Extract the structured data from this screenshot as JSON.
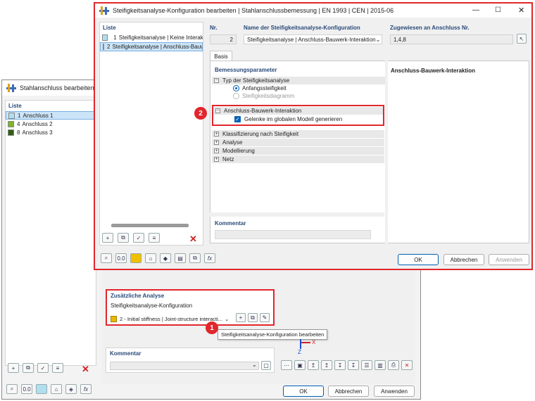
{
  "back_window": {
    "title": "Stahlanschluss bearbeiten",
    "list_title": "Liste",
    "items": [
      {
        "num": "1",
        "label": "Anschluss 1",
        "color": "#b0dff0"
      },
      {
        "num": "4",
        "label": "Anschluss 2",
        "color": "#7fb528"
      },
      {
        "num": "8",
        "label": "Anschluss 3",
        "color": "#2f5e10"
      }
    ],
    "additional_analysis": {
      "title": "Zusätzliche Analyse",
      "config_label": "Steifigkeitsanalyse-Konfiguration",
      "config_value": "2 - Initial stiffness | Joint-structure interacti...",
      "tooltip": "Steifigkeitsanalyse-Konfiguration bearbeiten"
    },
    "comment_title": "Kommentar",
    "buttons": {
      "ok": "OK",
      "cancel": "Abbrechen",
      "apply": "Anwenden"
    },
    "axis_z": "Z",
    "axis_x": "X"
  },
  "front_window": {
    "title": "Steifigkeitsanalyse-Konfiguration bearbeiten | Stahlanschlussbemessung | EN 1993 | CEN | 2015-06",
    "list_title": "Liste",
    "items": [
      {
        "num": "1",
        "label": "Steifigkeitsanalyse | Keine Interaktion",
        "color": "#b0dff0"
      },
      {
        "num": "2",
        "label": "Steifigkeitsanalyse | Anschluss-Bauwe",
        "color": "#8a8a20"
      }
    ],
    "nr_label": "Nr.",
    "nr_value": "2",
    "name_label": "Name der Steifigkeitsanalyse-Konfiguration",
    "name_value": "Steifigkeitsanalyse | Anschluss-Bauwerk-Interaktion",
    "assigned_label": "Zugewiesen an Anschluss Nr.",
    "assigned_value": "1,4,8",
    "tab": "Basis",
    "params_title": "Bemessungsparameter",
    "tree": {
      "type_group": "Typ der Steifigkeitsanalyse",
      "radio1": "Anfangssteifigkeit",
      "radio2": "Steifigkeitsdiagramm",
      "interaction_group": "Anschluss-Bauwerk-Interaktion",
      "checkbox": "Gelenke im globalen Modell generieren",
      "collapsed": [
        "Klassifizierung nach Steifigkeit",
        "Analyse",
        "Modellierung",
        "Netz"
      ]
    },
    "right_panel_title": "Anschluss-Bauwerk-Interaktion",
    "comment_title": "Kommentar",
    "buttons": {
      "ok": "OK",
      "cancel": "Abbrechen",
      "apply": "Anwenden"
    }
  },
  "badges": {
    "one": "1",
    "two": "2"
  },
  "accent_red": "#e1262c",
  "accent_blue": "#005fb8"
}
